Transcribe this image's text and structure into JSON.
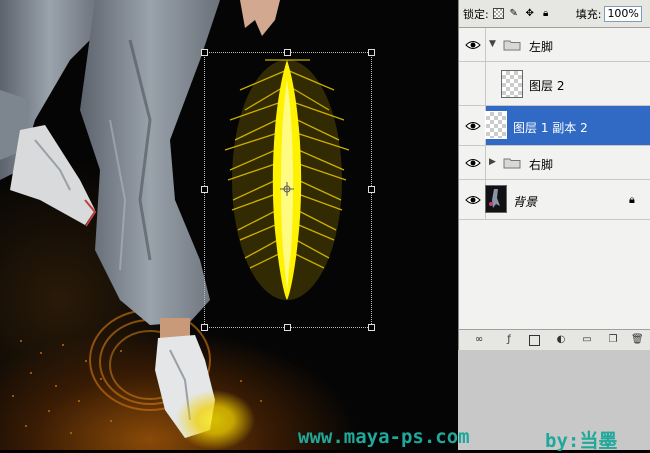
{
  "layers_panel": {
    "lock_label": "锁定:",
    "fill_label": "填充:",
    "fill_value": "100%",
    "layers": [
      {
        "name": "左脚",
        "kind": "group",
        "expanded": true,
        "visible": true
      },
      {
        "name": "图层 2",
        "kind": "layer",
        "visible": false
      },
      {
        "name": "图层 1 副本 2",
        "kind": "layer",
        "visible": true,
        "selected": true
      },
      {
        "name": "右脚",
        "kind": "group",
        "expanded": false,
        "visible": true
      },
      {
        "name": "背景",
        "kind": "background",
        "visible": true,
        "locked": true
      }
    ],
    "bottom_icons": [
      "link-icon",
      "fx-icon",
      "mask-icon",
      "adjustment-icon",
      "folder-icon",
      "new-layer-icon",
      "trash-icon"
    ]
  },
  "watermark": {
    "site": "www.maya-ps.com",
    "author": "by:当墨"
  },
  "colors": {
    "selection": "#316ac5",
    "feather_yellow": "#ffee00",
    "watermark": "#20a89a"
  }
}
